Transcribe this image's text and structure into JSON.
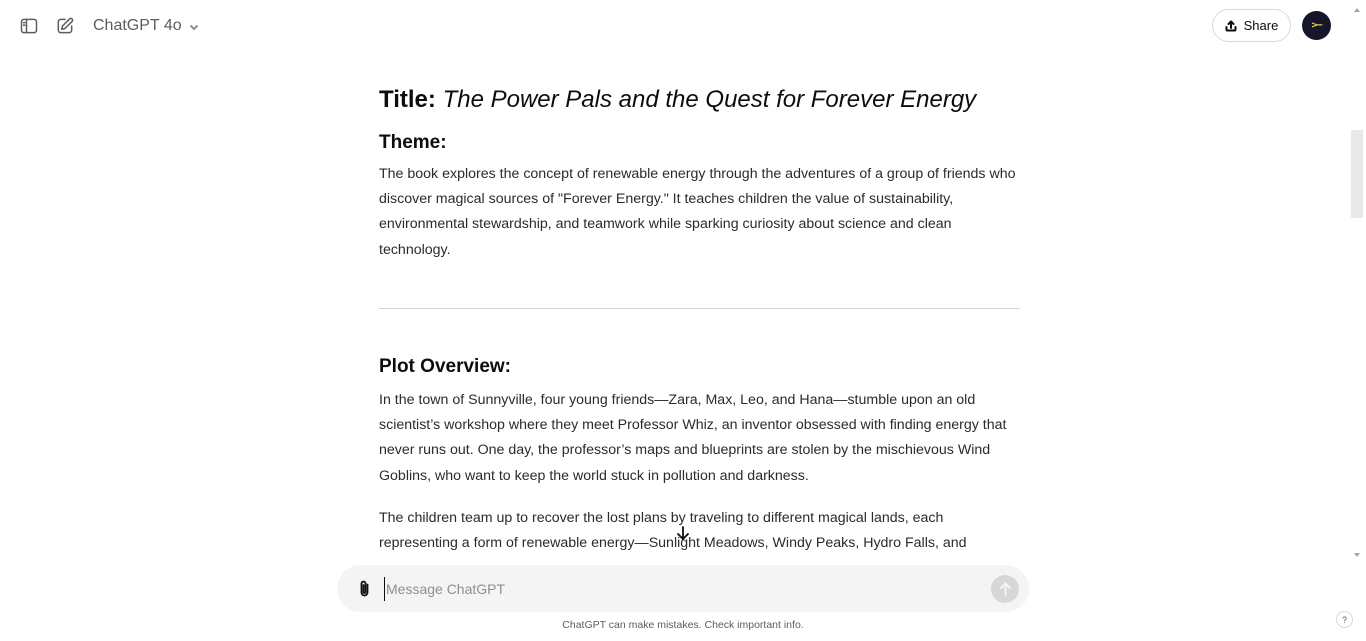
{
  "header": {
    "model_name": "ChatGPT 4o",
    "share_label": "Share",
    "avatar_text": ">−"
  },
  "document": {
    "title_prefix": "Title:",
    "book_title": "The Power Pals and the Quest for Forever Energy",
    "theme_heading": "Theme:",
    "theme_text": "The book explores the concept of renewable energy through the adventures of a group of friends who discover magical sources of \"Forever Energy.\" It teaches children the value of sustainability, environmental stewardship, and teamwork while sparking curiosity about science and clean technology.",
    "plot_heading": "Plot Overview:",
    "plot_para_1": "In the town of Sunnyville, four young friends—Zara, Max, Leo, and Hana—stumble upon an old scientist’s workshop where they meet Professor Whiz, an inventor obsessed with finding energy that never runs out. One day, the professor’s maps and blueprints are stolen by the mischievous Wind Goblins, who want to keep the world stuck in pollution and darkness.",
    "plot_para_2": "The children team up to recover the lost plans by traveling to different magical lands, each representing a form of renewable energy—Sunlight Meadows, Windy Peaks, Hydro Falls, and"
  },
  "composer": {
    "placeholder": "Message ChatGPT"
  },
  "footer": {
    "disclaimer": "ChatGPT can make mistakes. Check important info.",
    "help_label": "?"
  },
  "icons": {
    "sidebar_toggle": "sidebar-toggle-icon",
    "new_chat": "new-chat-icon",
    "chevron": "chevron-down-icon",
    "share": "share-icon",
    "attach": "paperclip-icon",
    "send": "arrow-up-icon",
    "scroll_down": "arrow-down-icon"
  }
}
